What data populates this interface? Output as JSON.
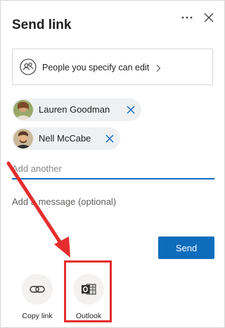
{
  "panel": {
    "title": "Send link"
  },
  "icons": {
    "more": "more-ellipsis-icon",
    "close": "close-icon",
    "people": "people-icon",
    "chevron": "chevron-right-icon",
    "remove": "remove-x-icon",
    "copy_link": "link-icon",
    "outlook": "outlook-icon"
  },
  "permission": {
    "label": "People you specify can edit"
  },
  "recipients": [
    {
      "name": "Lauren Goodman"
    },
    {
      "name": "Nell McCabe"
    }
  ],
  "add_input": {
    "placeholder": "Add another"
  },
  "message_input": {
    "placeholder": "Add a message (optional)"
  },
  "send": {
    "label": "Send"
  },
  "share_options": [
    {
      "label": "Copy link"
    },
    {
      "label": "Outlook"
    }
  ],
  "colors": {
    "accent": "#0f6cbd",
    "annotation": "#e52d2d",
    "chip_bg": "#eef0f2"
  }
}
